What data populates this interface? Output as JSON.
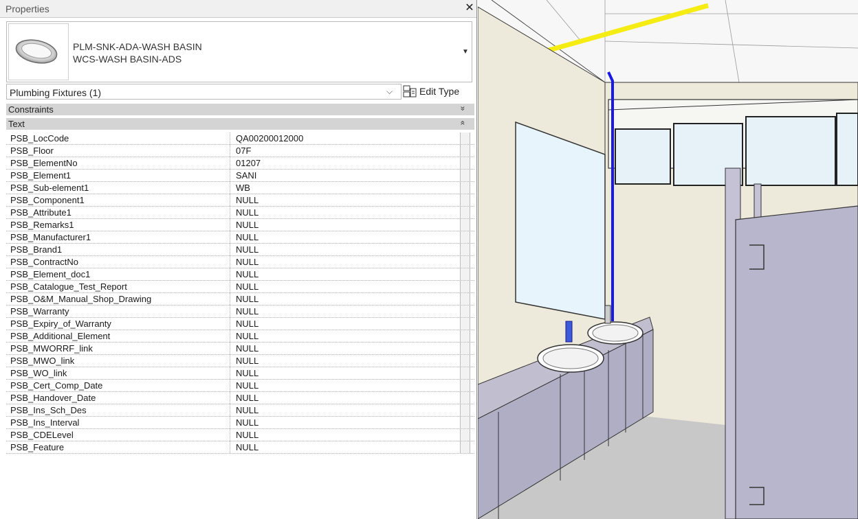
{
  "panel": {
    "title": "Properties",
    "close_glyph": "✕"
  },
  "type_selector": {
    "thumbnail_icon": "wash-basin-icon",
    "family": "PLM-SNK-ADA-WASH BASIN",
    "type": "WCS-WASH BASIN-ADS",
    "dropdown_glyph": "▼"
  },
  "filter": {
    "label": "Plumbing Fixtures (1)",
    "dropdown_glyph": "⌵"
  },
  "edit_type": {
    "label": "Edit Type",
    "icon": "edit-type-icon"
  },
  "groups": {
    "constraints": {
      "label": "Constraints",
      "chevron": "»"
    },
    "text": {
      "label": "Text",
      "chevron": "«"
    }
  },
  "properties": [
    {
      "name": "PSB_LocCode",
      "value": "QA00200012000"
    },
    {
      "name": "PSB_Floor",
      "value": "07F"
    },
    {
      "name": "PSB_ElementNo",
      "value": "01207"
    },
    {
      "name": "PSB_Element1",
      "value": "SANI"
    },
    {
      "name": "PSB_Sub-element1",
      "value": "WB"
    },
    {
      "name": "PSB_Component1",
      "value": "NULL"
    },
    {
      "name": "PSB_Attribute1",
      "value": "NULL"
    },
    {
      "name": "PSB_Remarks1",
      "value": "NULL"
    },
    {
      "name": "PSB_Manufacturer1",
      "value": "NULL"
    },
    {
      "name": "PSB_Brand1",
      "value": "NULL"
    },
    {
      "name": "PSB_ContractNo",
      "value": "NULL"
    },
    {
      "name": "PSB_Element_doc1",
      "value": "NULL"
    },
    {
      "name": "PSB_Catalogue_Test_Report",
      "value": "NULL"
    },
    {
      "name": "PSB_O&M_Manual_Shop_Drawing",
      "value": "NULL"
    },
    {
      "name": "PSB_Warranty",
      "value": "NULL"
    },
    {
      "name": "PSB_Expiry_of_Warranty",
      "value": "NULL"
    },
    {
      "name": "PSB_Additional_Element",
      "value": "NULL"
    },
    {
      "name": "PSB_MWORRF_link",
      "value": "NULL"
    },
    {
      "name": "PSB_MWO_link",
      "value": "NULL"
    },
    {
      "name": "PSB_WO_link",
      "value": "NULL"
    },
    {
      "name": "PSB_Cert_Comp_Date",
      "value": "NULL"
    },
    {
      "name": "PSB_Handover_Date",
      "value": "NULL"
    },
    {
      "name": "PSB_Ins_Sch_Des",
      "value": "NULL"
    },
    {
      "name": "PSB_Ins_Interval",
      "value": "NULL"
    },
    {
      "name": "PSB_CDELevel",
      "value": "NULL"
    },
    {
      "name": "PSB_Feature",
      "value": "NULL"
    }
  ],
  "viewport": {
    "scene": "3d-view-washroom",
    "colors": {
      "wall": "#eeeadb",
      "cabinet": "#b8b6cc",
      "pipe": "#1919e6",
      "highlight": "#f5ec14",
      "floor": "#c8c8c8"
    }
  }
}
